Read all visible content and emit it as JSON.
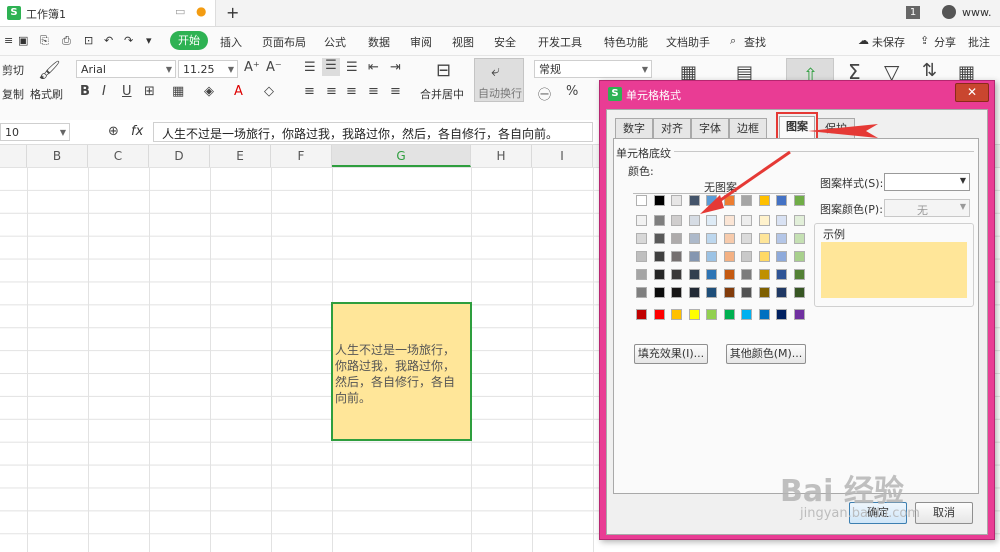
{
  "titlebar": {
    "doc_title": "工作簿1",
    "add_tab": "+",
    "badge": "1",
    "user": "www."
  },
  "menu": {
    "start": "开始",
    "items": [
      "插入",
      "页面布局",
      "公式",
      "数据",
      "审阅",
      "视图",
      "安全",
      "开发工具",
      "特色功能",
      "文档助手"
    ],
    "search": "查找",
    "unsaved": "未保存",
    "share": "分享",
    "annotate": "批注"
  },
  "ribbon": {
    "cut": "剪切",
    "copy": "复制",
    "format_painter": "格式刷",
    "font_name": "Arial",
    "font_size": "11.25",
    "merge_center": "合并居中",
    "wrap_text": "自动换行",
    "number_format": "常规"
  },
  "formula": {
    "name_box": "10",
    "fx": "fx",
    "content": "人生不过是一场旅行，你路过我，我路过你，然后，各自修行，各自向前。"
  },
  "columns": [
    "B",
    "C",
    "D",
    "E",
    "F",
    "G",
    "H",
    "I"
  ],
  "cell_text": "人生不过是一场旅行，你路过我，我路过你，然后，各自修行，各自向前。",
  "dialog": {
    "title": "单元格格式",
    "close": "✕",
    "tabs": [
      "数字",
      "对齐",
      "字体",
      "边框",
      "图案",
      "保护"
    ],
    "active_tab": "图案",
    "group_label": "单元格底纹",
    "color_label": "颜色:",
    "no_pattern": "无图案",
    "fill_effects": "填充效果(I)...",
    "more_colors": "其他颜色(M)...",
    "pattern_style_label": "图案样式(S):",
    "pattern_color_label": "图案颜色(P):",
    "pattern_color_value": "无",
    "sample_label": "示例",
    "sample_color": "#ffe699",
    "ok": "确定",
    "cancel": "取消"
  },
  "palette": {
    "theme_row": [
      "#ffffff",
      "#000000",
      "#e7e6e6",
      "#44546a",
      "#5b9bd5",
      "#ed7d31",
      "#a5a5a5",
      "#ffc000",
      "#4472c4",
      "#70ad47"
    ],
    "tint_rows": [
      [
        "#f2f2f2",
        "#7f7f7f",
        "#d0cece",
        "#d6dce4",
        "#deebf6",
        "#fbe5d5",
        "#ededed",
        "#fff2cc",
        "#d9e2f3",
        "#e2efd9"
      ],
      [
        "#d8d8d8",
        "#595959",
        "#aeabab",
        "#adb9ca",
        "#bdd7ee",
        "#f7cbac",
        "#dbdbdb",
        "#fee599",
        "#b4c6e7",
        "#c5e0b3"
      ],
      [
        "#bfbfbf",
        "#3f3f3f",
        "#757070",
        "#8496b0",
        "#9cc3e5",
        "#f4b183",
        "#c9c9c9",
        "#ffd965",
        "#8eaadb",
        "#a8d08d"
      ],
      [
        "#a5a5a5",
        "#262626",
        "#3a3838",
        "#323f4f",
        "#2e75b5",
        "#c55a11",
        "#7b7b7b",
        "#bf9000",
        "#2f5496",
        "#538135"
      ],
      [
        "#7f7f7f",
        "#0c0c0c",
        "#171616",
        "#222a35",
        "#1e4e79",
        "#833c0b",
        "#525252",
        "#7f6000",
        "#1f3864",
        "#375623"
      ]
    ],
    "standard_row": [
      "#c00000",
      "#ff0000",
      "#ffc000",
      "#ffff00",
      "#92d050",
      "#00b050",
      "#00b0f0",
      "#0070c0",
      "#002060",
      "#7030a0"
    ],
    "selected": "#ffe699"
  },
  "watermark": {
    "brand": "Bai 经验",
    "url": "jingyan.baidu.com"
  }
}
